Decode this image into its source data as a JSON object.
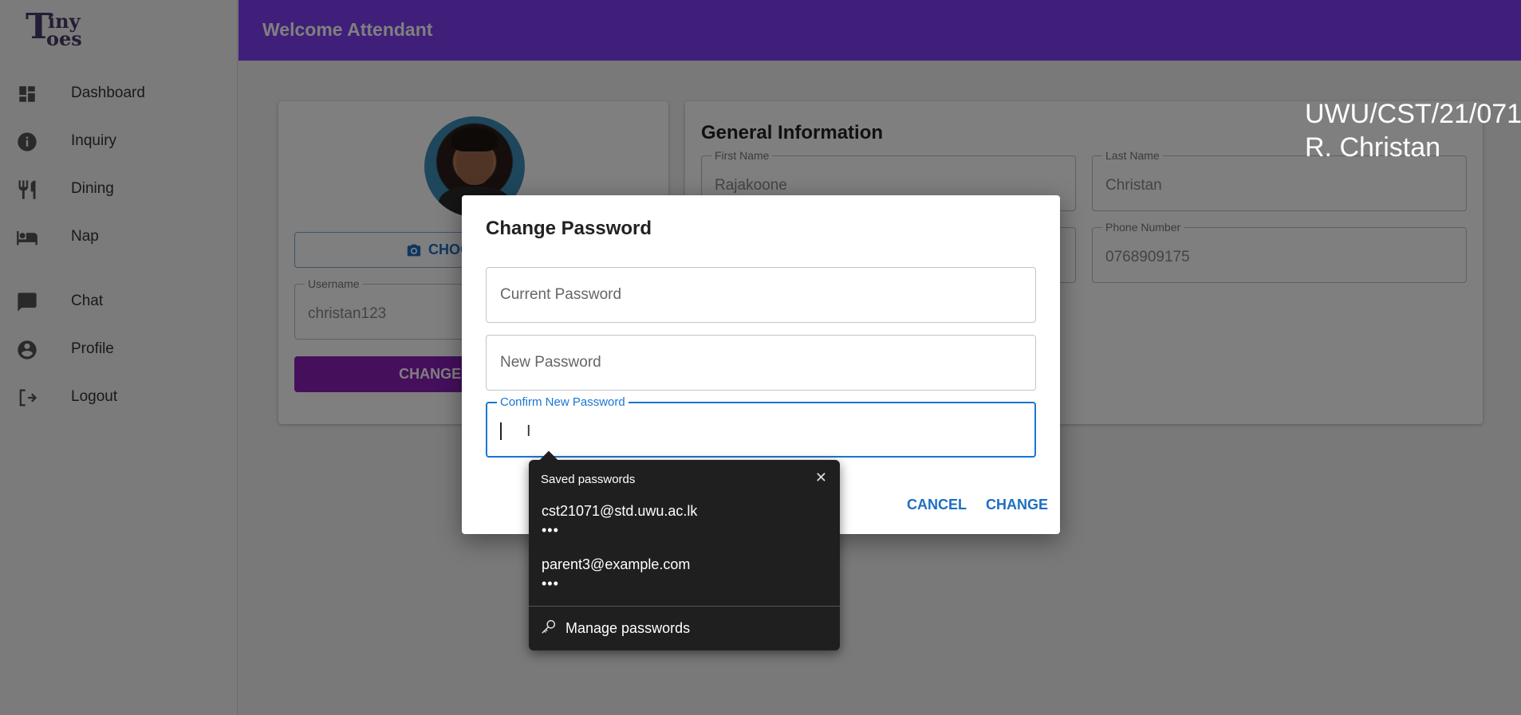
{
  "app": {
    "logo_text": "TinyToes"
  },
  "header": {
    "title": "Welcome Attendant"
  },
  "sidebar": {
    "items": [
      {
        "label": "Dashboard",
        "icon": "dashboard-icon"
      },
      {
        "label": "Inquiry",
        "icon": "info-icon"
      },
      {
        "label": "Dining",
        "icon": "utensils-icon"
      },
      {
        "label": "Nap",
        "icon": "bed-icon"
      },
      {
        "label": "Chat",
        "icon": "chat-icon"
      },
      {
        "label": "Profile",
        "icon": "account-circle-icon"
      },
      {
        "label": "Logout",
        "icon": "logout-icon"
      }
    ]
  },
  "profile_card": {
    "choose_button_label": "CHOOSE IMAGE",
    "username_label": "Username",
    "username_value": "christan123",
    "change_button_label": "CHANGE PASSWORD"
  },
  "general_info": {
    "title": "General Information",
    "first_name_label": "First Name",
    "first_name_value": "Rajakoone",
    "last_name_label": "Last Name",
    "last_name_value": "Christan",
    "phone_label": "Phone Number",
    "phone_value": "0768909175"
  },
  "watermark": {
    "line1": "UWU/CST/21/071",
    "line2": "R. Christan"
  },
  "dialog": {
    "title": "Change Password",
    "current_password_placeholder": "Current Password",
    "new_password_placeholder": "New Password",
    "confirm_password_label": "Confirm New Password",
    "cancel_label": "CANCEL",
    "change_label": "CHANGE"
  },
  "saved_passwords": {
    "title": "Saved passwords",
    "close_glyph": "✕",
    "entries": [
      {
        "username": "cst21071@std.uwu.ac.lk",
        "password_mask": "•••"
      },
      {
        "username": "parent3@example.com",
        "password_mask": "•••"
      }
    ],
    "manage_label": "Manage passwords"
  },
  "colors": {
    "header_bg": "#7e3ff2",
    "primary_blue": "#1976d2",
    "change_button_bg": "#8a1fb8"
  }
}
